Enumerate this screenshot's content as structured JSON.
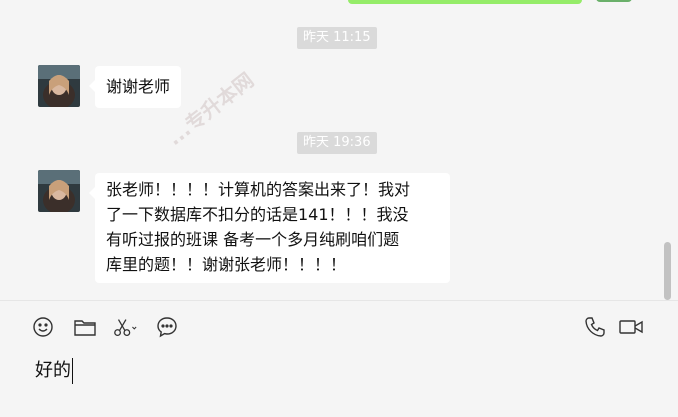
{
  "timestamps": [
    "昨天 11:15",
    "昨天 19:36"
  ],
  "messages": [
    {
      "text": "谢谢老师"
    },
    {
      "lines": [
        "张老师！！！！计算机的答案出来了！我对",
        "了一下数据库不扣分的话是141！！！我没",
        "有听过报的班课 备考一个多月纯刷咱们题",
        "库里的题！！谢谢张老师！！！！"
      ]
    }
  ],
  "watermark": "...专升本网",
  "toolbar": {
    "icons": [
      "emoji-icon",
      "folder-icon",
      "scissors-icon",
      "chat-history-icon",
      "phone-icon",
      "video-icon"
    ]
  },
  "input": {
    "value": "好的"
  },
  "colors": {
    "sent_bubble": "#95ec69",
    "received_bubble": "#ffffff",
    "timestamp_bg": "#dadada"
  }
}
